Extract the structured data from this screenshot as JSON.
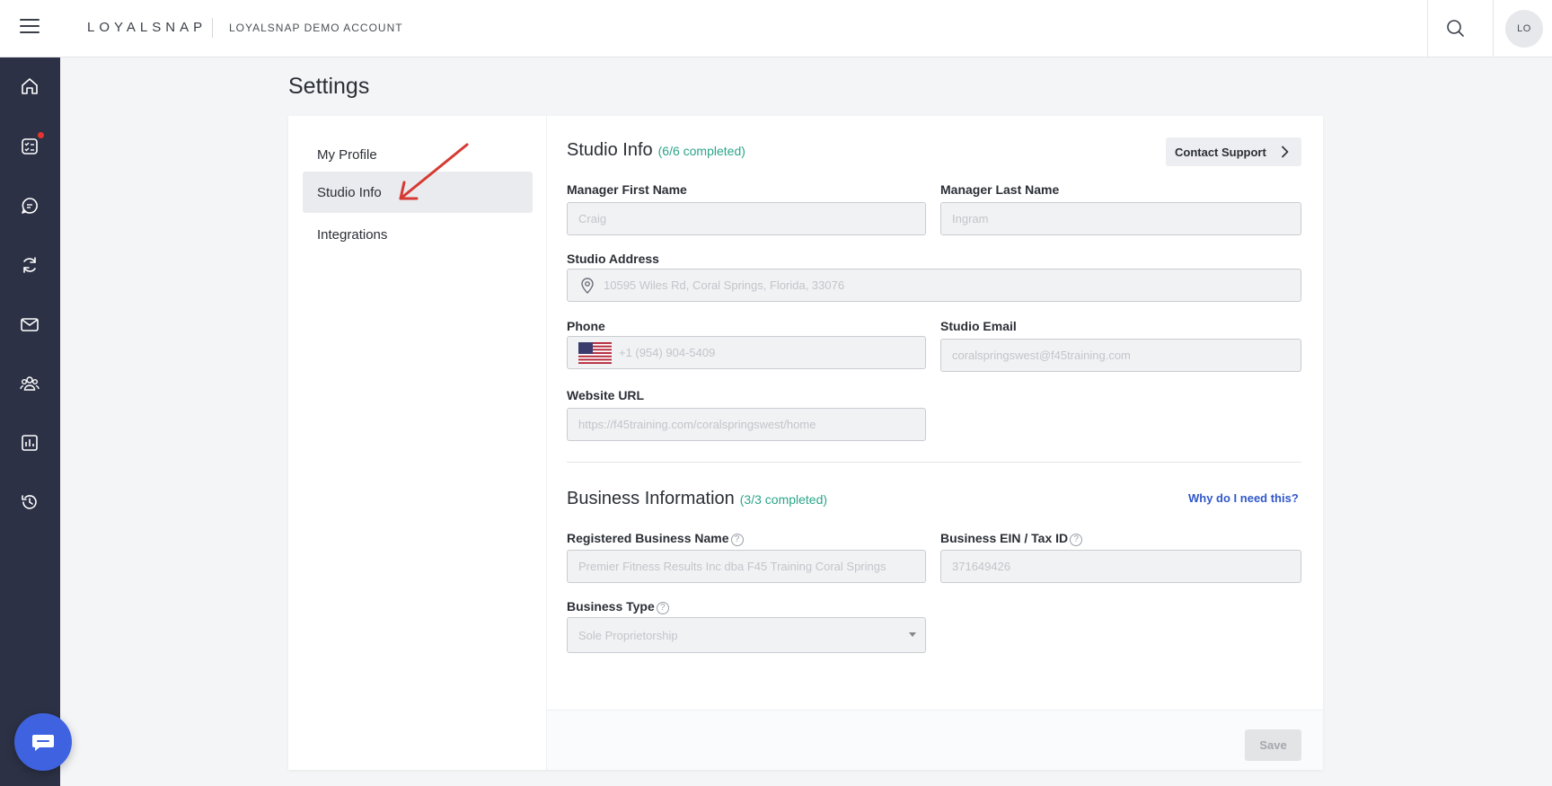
{
  "header": {
    "brand": "LOYALSNAP",
    "account": "LOYALSNAP DEMO ACCOUNT",
    "avatar_initials": "LO"
  },
  "sidebar": {
    "icons": [
      "home-icon",
      "checklist-icon",
      "chat-icon",
      "refresh-icon",
      "mail-icon",
      "people-icon",
      "report-icon",
      "history-icon"
    ],
    "notification_icon": "checklist-icon"
  },
  "page": {
    "title": "Settings"
  },
  "settings_nav": {
    "items": [
      {
        "label": "My Profile",
        "active": false
      },
      {
        "label": "Studio Info",
        "active": true
      },
      {
        "label": "Integrations",
        "active": false
      }
    ]
  },
  "studio_info": {
    "title": "Studio Info",
    "completion": "(6/6 completed)",
    "contact_support": "Contact Support",
    "fields": {
      "manager_first_name": {
        "label": "Manager First Name",
        "value": "Craig"
      },
      "manager_last_name": {
        "label": "Manager Last Name",
        "value": "Ingram"
      },
      "studio_address": {
        "label": "Studio Address",
        "value": "10595 Wiles Rd, Coral Springs, Florida, 33076"
      },
      "phone": {
        "label": "Phone",
        "value": "+1 (954) 904-5409"
      },
      "studio_email": {
        "label": "Studio Email",
        "value": "coralspringswest@f45training.com"
      },
      "website_url": {
        "label": "Website URL",
        "value": "https://f45training.com/coralspringswest/home"
      }
    }
  },
  "business_info": {
    "title": "Business Information",
    "completion": "(3/3 completed)",
    "why_link": "Why do I need this?",
    "fields": {
      "registered_name": {
        "label": "Registered Business Name",
        "value": "Premier Fitness Results Inc dba F45 Training Coral Springs"
      },
      "ein": {
        "label": "Business EIN / Tax ID",
        "value": "371649426"
      },
      "business_type": {
        "label": "Business Type",
        "value": "Sole Proprietorship"
      }
    }
  },
  "footer": {
    "save": "Save"
  },
  "colors": {
    "sidebar": "#2c3145",
    "completed": "#2ba58a",
    "link": "#3158c9",
    "chat_fab": "#3f63e0",
    "annotation_arrow": "#d63a32"
  }
}
